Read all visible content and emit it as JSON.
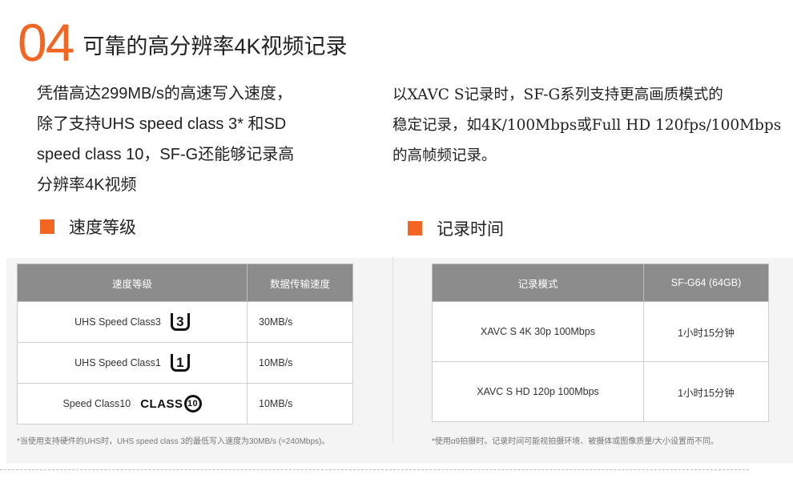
{
  "header": {
    "number": "04",
    "title": "可靠的高分辨率4K视频记录"
  },
  "left_paragraph": [
    "凭借高达299MB/s的高速写入速度，",
    "除了支持UHS speed class 3* 和SD",
    "speed class 10，SF-G还能够记录高",
    "分辨率4K视频"
  ],
  "right_paragraph": [
    "以XAVC S记录时，SF-G系列支持更高画质模式的",
    "稳定记录，如4K/100Mbps或Full HD 120fps/100Mbps",
    "的高帧频记录。"
  ],
  "sections": {
    "left_label": "速度等级",
    "right_label": "记录时间"
  },
  "speed_table": {
    "headers": [
      "速度等级",
      "数据传输速度"
    ],
    "rows": [
      {
        "label": "UHS Speed Class3",
        "badge": "3",
        "badge_icon": "uhs-speed-class-3-icon",
        "speed": "30MB/s"
      },
      {
        "label": "UHS Speed Class1",
        "badge": "1",
        "badge_icon": "uhs-speed-class-1-icon",
        "speed": "10MB/s"
      },
      {
        "label": "Speed Class10",
        "badge": "CLASS",
        "badge_num": "10",
        "badge_icon": "sd-class-10-icon",
        "speed": "10MB/s"
      }
    ],
    "note": "*当使用支持硬件的UHS时，UHS speed class 3的最低写入速度为30MB/s (=240Mbps)。"
  },
  "record_table": {
    "headers": [
      "记录模式",
      "SF-G64 (64GB)"
    ],
    "rows": [
      {
        "mode": "XAVC S 4K 30p 100Mbps",
        "time": "1小时15分钟"
      },
      {
        "mode": "XAVC S HD 120p 100Mbps",
        "time": "1小时15分钟"
      }
    ],
    "note": "*使用α9拍摄时。记录时间可能视拍摄环境、被摄体或图像质量/大小设置而不同。"
  },
  "colors": {
    "accent": "#f26522",
    "table_header": "#8c8c8c",
    "panel_bg": "#f4f4f4"
  }
}
